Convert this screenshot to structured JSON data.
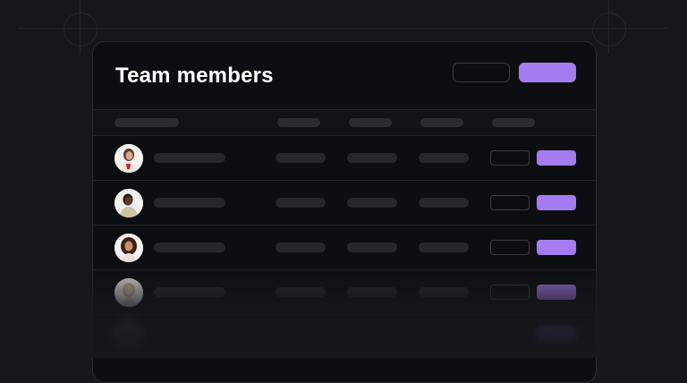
{
  "header": {
    "title": "Team members",
    "secondary_button_label": "",
    "primary_button_label": ""
  },
  "colors": {
    "background": "#16171b",
    "card": "#0d0e11",
    "accent": "#a57bf0",
    "placeholder": "#25272c"
  },
  "table": {
    "columns": [
      "",
      "",
      "",
      "",
      ""
    ],
    "rows": [
      {
        "avatar": "avatar-woman-red-top-icon",
        "name": "",
        "col2": "",
        "col3": "",
        "col4": ""
      },
      {
        "avatar": "avatar-man-beige-shirt-icon",
        "name": "",
        "col2": "",
        "col3": "",
        "col4": ""
      },
      {
        "avatar": "avatar-woman-curly-hair-icon",
        "name": "",
        "col2": "",
        "col3": "",
        "col4": ""
      },
      {
        "avatar": "avatar-woman-blonde-icon",
        "name": "",
        "col2": "",
        "col3": "",
        "col4": ""
      }
    ]
  }
}
